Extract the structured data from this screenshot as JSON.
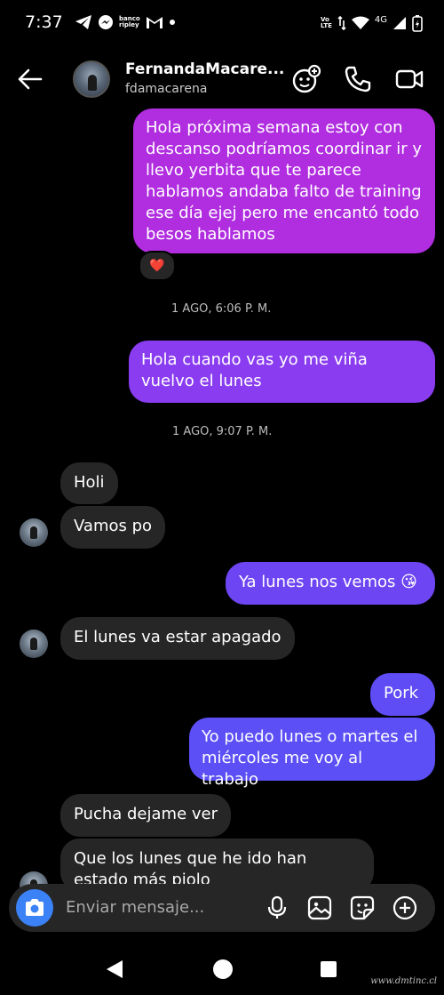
{
  "status_bar": {
    "time": "7:37",
    "app_icons": [
      "telegram-icon",
      "messenger-icon",
      "banco-ripley-icon",
      "gmail-icon",
      "dot-icon"
    ],
    "banco_label_1": "banco",
    "banco_label_2": "ripley",
    "volte_1": "Vo",
    "volte_2": "LTE",
    "network": "4G"
  },
  "header": {
    "name": "FernandaMacare...",
    "username": "fdamacarena"
  },
  "messages": [
    {
      "type": "outgoing",
      "text": "Hola próxima semana estoy con descanso podríamos coordinar ir y llevo yerbita que te parece hablamos andaba falto de training ese día ejej pero me encantó todo besos hablamos"
    },
    {
      "type": "reaction",
      "emoji": "❤️"
    },
    {
      "type": "timestamp",
      "text": "1 AGO, 6:06 P. M."
    },
    {
      "type": "outgoing",
      "text": "Hola cuando vas yo me viña vuelvo el lunes"
    },
    {
      "type": "timestamp",
      "text": "1 AGO, 9:07 P. M."
    },
    {
      "type": "incoming",
      "text": "Holi"
    },
    {
      "type": "incoming",
      "text": "Vamos po"
    },
    {
      "type": "outgoing",
      "text": "Ya lunes nos vemos 😘"
    },
    {
      "type": "incoming",
      "text": "El lunes va estar apagado"
    },
    {
      "type": "outgoing",
      "text": "Pork"
    },
    {
      "type": "outgoing",
      "text": "Yo puedo lunes o martes el miércoles me voy al trabajo"
    },
    {
      "type": "incoming",
      "text": "Pucha dejame ver"
    },
    {
      "type": "incoming",
      "text": "Que los lunes que he ido han estado más piolo"
    }
  ],
  "composer": {
    "placeholder": "Enviar mensaje..."
  },
  "watermark": "www.dmtinc.cl",
  "colors": {
    "bubble_magenta": "#b02de0",
    "bubble_purple": "#8a3cf0",
    "bubble_violet": "#5b4ff5",
    "bubble_incoming": "#262626",
    "accent_blue": "#3b82f6"
  }
}
